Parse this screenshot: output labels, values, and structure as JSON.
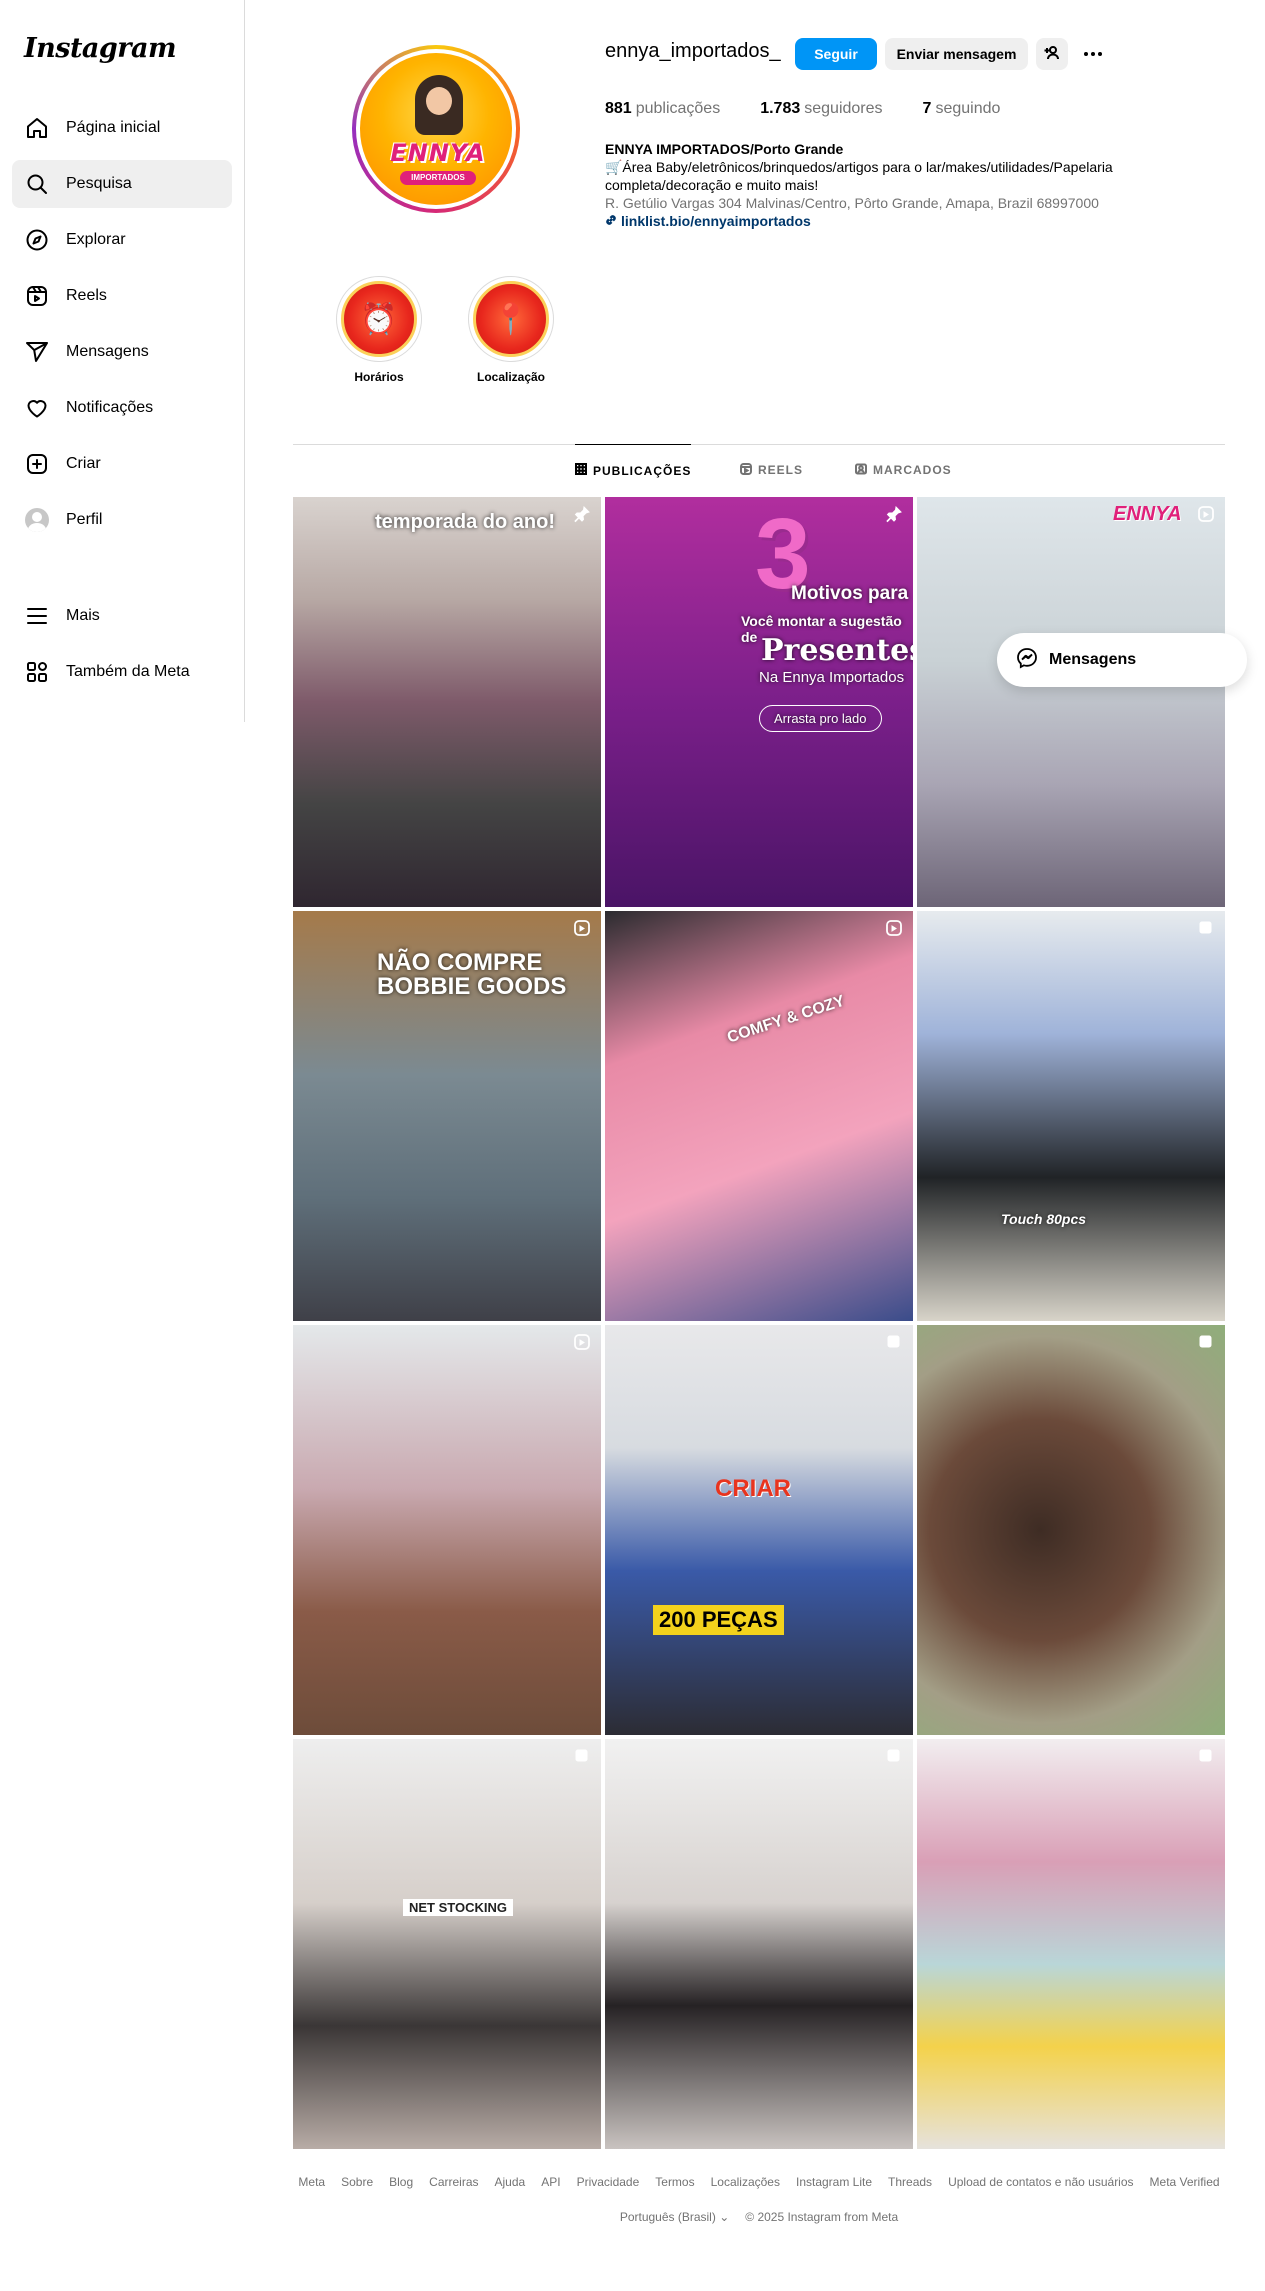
{
  "app": {
    "logo_text": "Instagram"
  },
  "sidebar": {
    "items": [
      {
        "label": "Página inicial",
        "icon": "home-icon"
      },
      {
        "label": "Pesquisa",
        "icon": "search-icon",
        "active": true
      },
      {
        "label": "Explorar",
        "icon": "compass-icon"
      },
      {
        "label": "Reels",
        "icon": "reels-icon"
      },
      {
        "label": "Mensagens",
        "icon": "send-icon"
      },
      {
        "label": "Notificações",
        "icon": "heart-icon"
      },
      {
        "label": "Criar",
        "icon": "plus-square-icon"
      },
      {
        "label": "Perfil",
        "icon": "avatar"
      }
    ],
    "bottom": [
      {
        "label": "Mais",
        "icon": "menu-icon"
      },
      {
        "label": "Também da Meta",
        "icon": "meta-grid-icon"
      }
    ]
  },
  "profile": {
    "username": "ennya_importados_",
    "follow_label": "Seguir",
    "message_label": "Enviar mensagem",
    "logo_text": "ENNYA",
    "logo_sub": "IMPORTADOS",
    "stats": {
      "posts_count": "881",
      "posts_label": "publicações",
      "followers_count": "1.783",
      "followers_label": "seguidores",
      "following_count": "7",
      "following_label": "seguindo"
    },
    "bio": {
      "name": "ENNYA IMPORTADOS/Porto Grande",
      "line1": "🛒Área Baby/eletrônicos/brinquedos/artigos para o lar/makes/utilidades/Papelaria",
      "line2": "completa/decoração e muito mais!",
      "address": "R. Getúlio Vargas 304 Malvinas/Centro, Pôrto Grande, Amapa, Brazil 68997000",
      "link": "linklist.bio/ennyaimportados"
    }
  },
  "highlights": [
    {
      "label": "Horários",
      "glyph": "⏰"
    },
    {
      "label": "Localização",
      "glyph": "📍"
    }
  ],
  "tabs": [
    {
      "label": "PUBLICAÇÕES",
      "active": true
    },
    {
      "label": "REELS"
    },
    {
      "label": "MARCADOS"
    }
  ],
  "posts": {
    "p1_caption_a": "...",
    "p1_caption_b": "temporada do ano!",
    "p2_number": "3",
    "p2_line1": "Motivos para",
    "p2_line2": "Você montar a sugestão de",
    "p2_line3": "Presentes",
    "p2_line4": "Na Ennya Importados",
    "p2_cta": "Arrasta pro lado",
    "p3_brand": "ENNYA",
    "p4_caption": "NÃO COMPRE BOBBIE GOODS",
    "p5_caption": "COMFY & COZY",
    "p6_caption": "Touch 80pcs",
    "p8_line1": "CRIAR",
    "p8_line2": "200 PEÇAS",
    "p10_caption": "NET STOCKING"
  },
  "floating_messages": {
    "label": "Mensagens"
  },
  "footer": {
    "links": [
      "Meta",
      "Sobre",
      "Blog",
      "Carreiras",
      "Ajuda",
      "API",
      "Privacidade",
      "Termos",
      "Localizações",
      "Instagram Lite",
      "Threads",
      "Upload de contatos e não usuários",
      "Meta Verified"
    ],
    "language": "Português (Brasil)",
    "copyright": "© 2025 Instagram from Meta"
  }
}
